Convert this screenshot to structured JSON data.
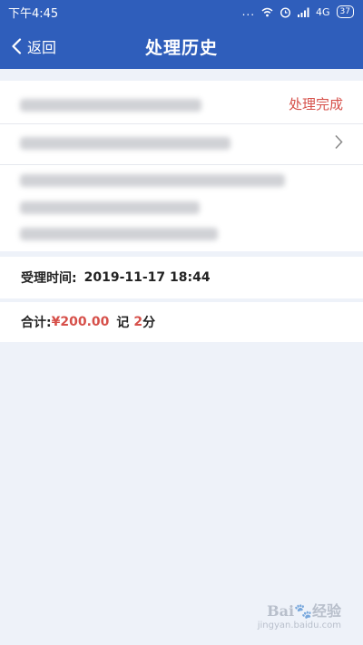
{
  "status_bar": {
    "time": "下午4:45",
    "dots": "...",
    "network": "4G",
    "battery": "37"
  },
  "nav": {
    "back_label": "返回",
    "title": "处理历史"
  },
  "record": {
    "status": "处理完成",
    "accept_time_label": "受理时间:",
    "accept_time_value": "2019-11-17 18:44",
    "total_label": "合计:",
    "amount": "¥200.00",
    "points_prefix": "记",
    "points_value": "2",
    "points_suffix": "分"
  },
  "watermark": {
    "logo": "Bai🐾经验",
    "url": "jingyan.baidu.com"
  },
  "colors": {
    "brand_blue": "#2f5ebb",
    "accent_red": "#d6504a",
    "page_bg": "#eef2f9"
  },
  "icons": [
    "back-chevron-icon",
    "chevron-right-icon",
    "wifi-icon",
    "alarm-icon",
    "signal-icon",
    "battery-icon"
  ]
}
